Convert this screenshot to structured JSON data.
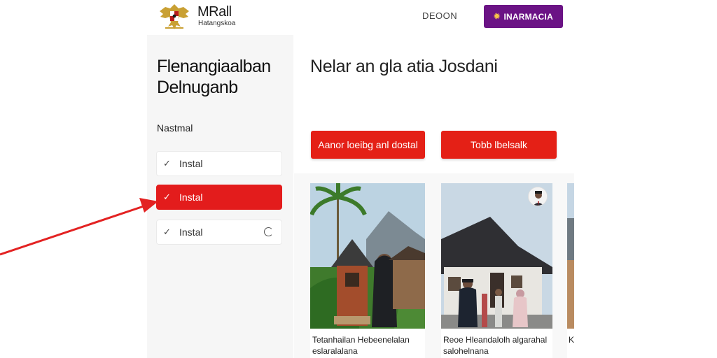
{
  "header": {
    "title": "MRall",
    "subtitle": "Hatangskoa",
    "link_label": "DEOON",
    "cta_label": "INARMACIA",
    "cta_icon": "star-icon",
    "cta_color": "#6b1385"
  },
  "sidebar": {
    "title": "Flenangiaalban Delnuganb",
    "section_label": "Nastmal",
    "items": [
      {
        "label": "Instal",
        "icon": "check-icon",
        "active": false
      },
      {
        "label": "Instal",
        "icon": "check-icon",
        "active": true
      },
      {
        "label": "Instal",
        "icon": "check-icon",
        "active": false,
        "trailing_icon": "refresh-icon"
      }
    ],
    "accent": "#e31c1c"
  },
  "main": {
    "heading": "Nelar an gla atia Josdani",
    "buttons": [
      {
        "label": "Aanor loeibg anl dostal"
      },
      {
        "label": "Tobb lbelsalk"
      }
    ],
    "cards": [
      {
        "caption": "Tetanhailan Hebeenelalan eslaralalana"
      },
      {
        "caption": "Reoe Hleandalolh algarahal salohelnana"
      },
      {
        "caption": "K"
      }
    ]
  }
}
